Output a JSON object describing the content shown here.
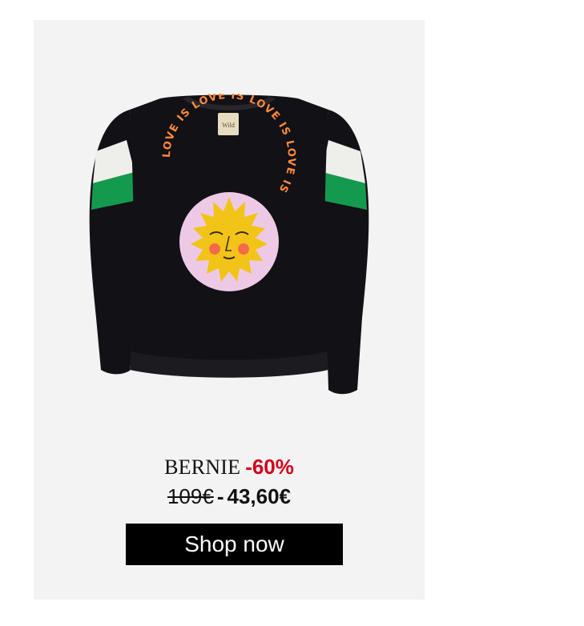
{
  "product": {
    "name": "BERNIE",
    "discount": "-60%",
    "old_price": "109€",
    "separator": "-",
    "new_price": "43,60€",
    "cta_label": "Shop now",
    "image_icon": "sweatshirt-image"
  },
  "graphic": {
    "ring_text": "LOVE IS LOVE IS LOVE IS LOVE IS",
    "label_text": "Wild"
  },
  "colors": {
    "card_background": "#f3f3f3",
    "sweatshirt": "#111116",
    "sleeve_white": "#eeeeea",
    "sleeve_green": "#149a4e",
    "sun_yellow": "#f2c418",
    "circle_pink": "#eec9e6",
    "discount_red": "#d0021b",
    "button_black": "#000000"
  }
}
